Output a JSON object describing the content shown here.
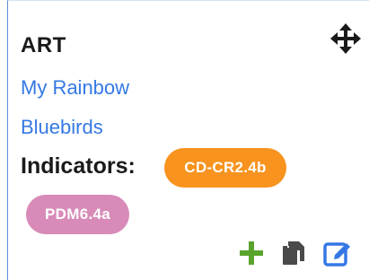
{
  "card": {
    "title": "ART",
    "links": [
      {
        "label": "My Rainbow"
      },
      {
        "label": "Bluebirds"
      }
    ],
    "indicators_label": "Indicators:",
    "indicators": [
      {
        "code": "CD-CR2.4b",
        "color": "#f7931e"
      },
      {
        "code": "PDM6.4a",
        "color": "#d88bb8"
      }
    ],
    "icons": {
      "move": "move-arrows-icon",
      "add": "plus-icon",
      "copy": "copy-icon",
      "edit": "edit-icon"
    },
    "colors": {
      "link": "#3578e5",
      "add": "#5aa42e",
      "copy": "#4a4a4a",
      "edit": "#3578e5"
    }
  }
}
